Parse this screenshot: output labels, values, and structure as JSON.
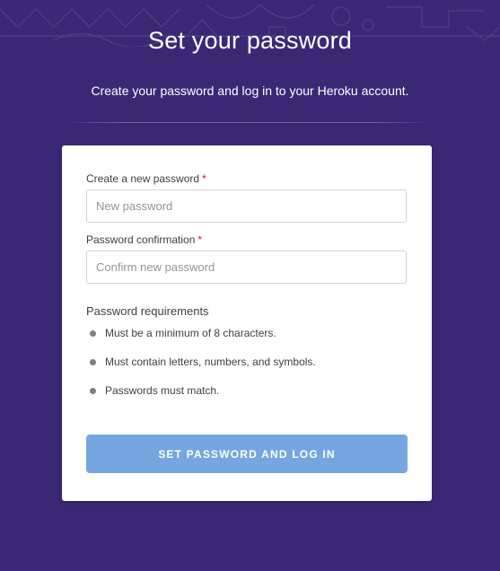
{
  "page": {
    "title": "Set your password",
    "subtitle": "Create your password and log in to your Heroku account."
  },
  "form": {
    "new_password": {
      "label": "Create a new password",
      "required_mark": "*",
      "placeholder": "New password",
      "value": ""
    },
    "confirm_password": {
      "label": "Password confirmation",
      "required_mark": "*",
      "placeholder": "Confirm new password",
      "value": ""
    },
    "requirements": {
      "title": "Password requirements",
      "items": [
        "Must be a minimum of 8 characters.",
        "Must contain letters, numbers, and symbols.",
        "Passwords must match."
      ]
    },
    "submit_label": "SET PASSWORD AND LOG IN"
  },
  "colors": {
    "background": "#3b2875",
    "card": "#ffffff",
    "button": "#76a6e0",
    "required": "#c5252b"
  },
  "icons": {
    "requirement_bullet": "bullet-icon",
    "header_pattern": "decorative-pattern"
  }
}
